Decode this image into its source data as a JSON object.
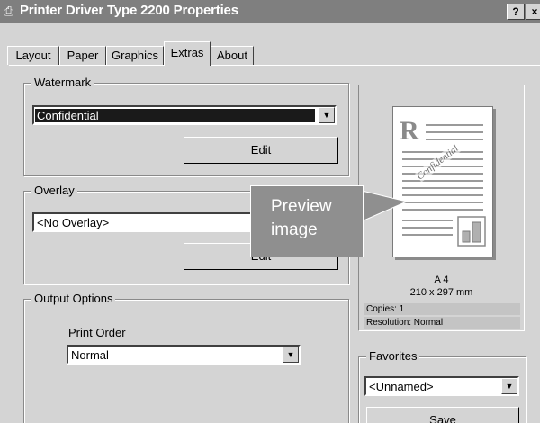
{
  "window": {
    "title": "Printer Driver Type 2200 Properties",
    "help_button": "?",
    "close_button": "×"
  },
  "tabs": [
    "Layout",
    "Paper",
    "Graphics",
    "Extras",
    "About"
  ],
  "active_tab": "Extras",
  "watermark": {
    "legend": "Watermark",
    "selected": "Confidential",
    "edit_label": "Edit"
  },
  "overlay": {
    "legend": "Overlay",
    "selected": "<No Overlay>",
    "edit_label": "Edit"
  },
  "output": {
    "legend": "Output Options",
    "print_order_label": "Print Order",
    "print_order_value": "Normal"
  },
  "preview": {
    "paper_size": "A 4",
    "dimensions": "210 x 297 mm",
    "copies": "Copies: 1",
    "resolution": "Resolution: Normal",
    "watermark_text": "Confidential",
    "header_letter": "R"
  },
  "favorites": {
    "legend": "Favorites",
    "selected": "<Unnamed>",
    "save_label": "Save"
  },
  "callout": {
    "line1": "Preview",
    "line2": "image"
  },
  "colors": {
    "titlebar": "#7f7f7f",
    "face": "#d4d4d4",
    "callout": "#8f8f8f"
  }
}
